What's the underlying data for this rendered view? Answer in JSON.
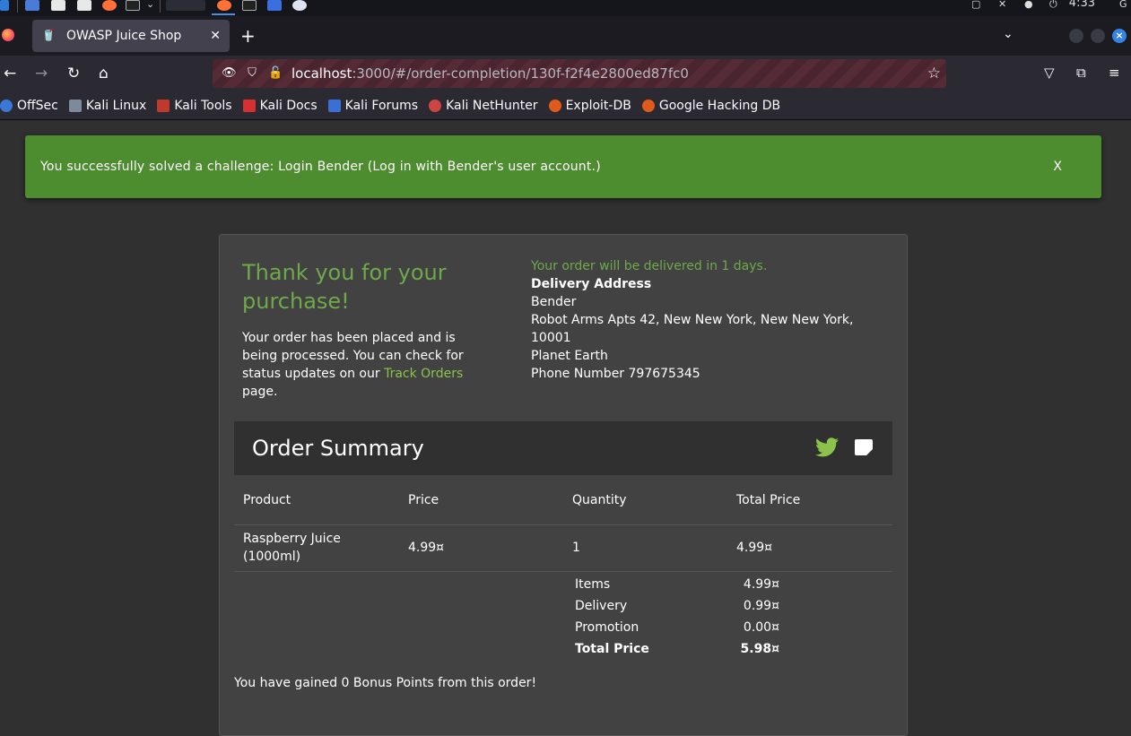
{
  "taskbar": {
    "time": "4:33"
  },
  "browser": {
    "tab_title": "OWASP Juice Shop",
    "url_host": "localhost",
    "url_rest": ":3000/#/order-completion/130f-f2f4e2800ed87fc0",
    "bookmarks": [
      "OffSec",
      "Kali Linux",
      "Kali Tools",
      "Kali Docs",
      "Kali Forums",
      "Kali NetHunter",
      "Exploit-DB",
      "Google Hacking DB"
    ]
  },
  "snackbar": {
    "message": "You successfully solved a challenge: Login Bender (Log in with Bender's user account.)",
    "dismiss": "X"
  },
  "confirmation": {
    "title": "Thank you for your purchase!",
    "text_before": "Your order has been placed and is being processed. You can check for status updates on our ",
    "link": "Track Orders",
    "text_after": " page."
  },
  "delivery": {
    "eta": "Your order will be delivered in 1 days.",
    "heading": "Delivery Address",
    "name": "Bender",
    "street": "Robot Arms Apts 42, New New York, New New York, 10001",
    "country": "Planet Earth",
    "phone": "Phone Number 797675345"
  },
  "summary": {
    "title": "Order Summary",
    "columns": [
      "Product",
      "Price",
      "Quantity",
      "Total Price"
    ],
    "rows": [
      {
        "product": "Raspberry Juice (1000ml)",
        "price": "4.99¤",
        "quantity": "1",
        "total": "4.99¤"
      }
    ],
    "totals": [
      {
        "label": "Items",
        "value": "4.99¤"
      },
      {
        "label": "Delivery",
        "value": "0.99¤"
      },
      {
        "label": "Promotion",
        "value": "0.00¤"
      },
      {
        "label": "Total Price",
        "value": "5.98¤"
      }
    ],
    "bonus": "You have gained 0 Bonus Points from this order!"
  },
  "colors": {
    "accent_green": "#6ea94a",
    "snackbar": "#4d8c2f",
    "link": "#8bc34a"
  }
}
